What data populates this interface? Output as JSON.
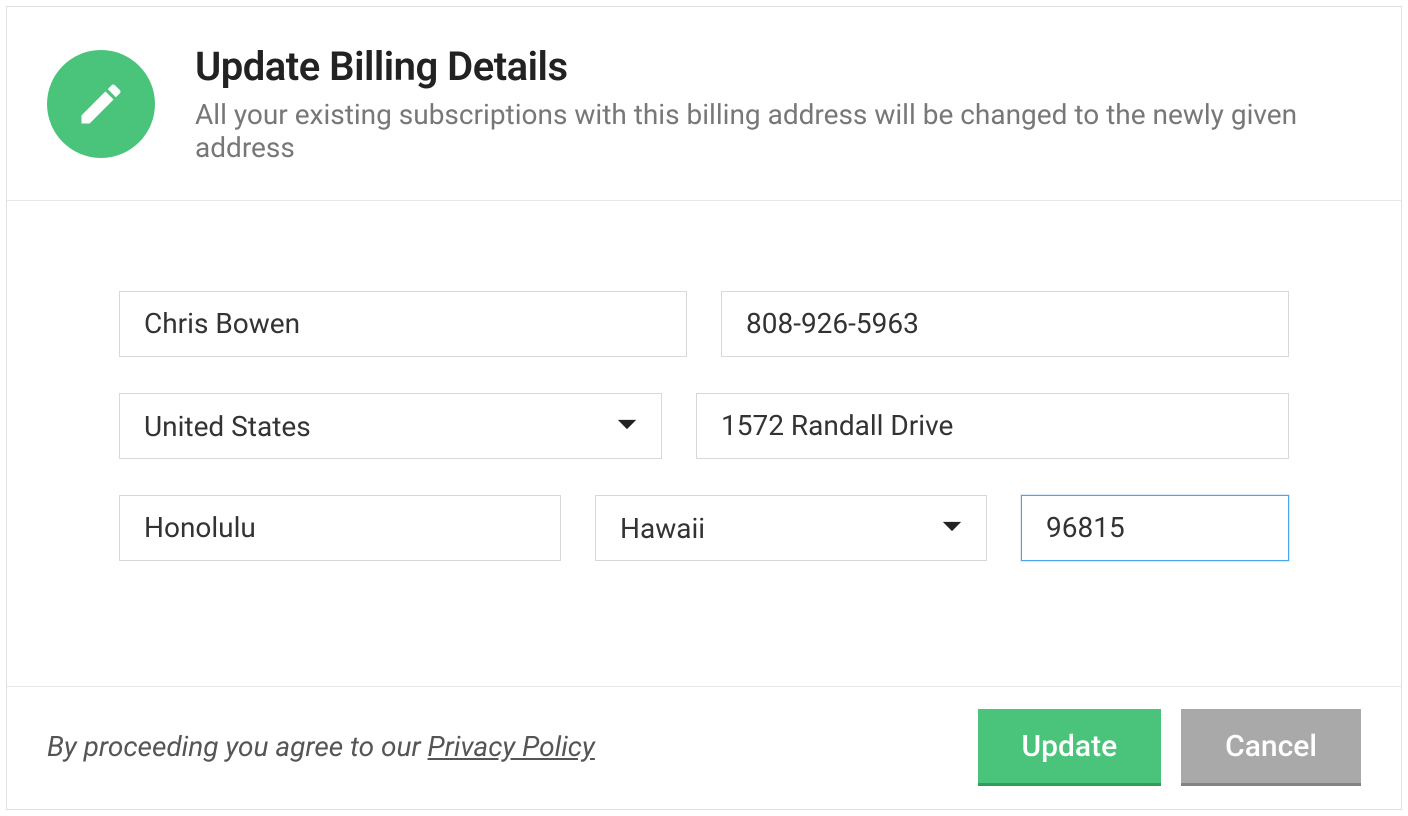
{
  "header": {
    "title": "Update Billing Details",
    "subtitle": "All your existing subscriptions with this billing address will be changed to the newly given address"
  },
  "form": {
    "name": "Chris Bowen",
    "phone": "808-926-5963",
    "country": "United States",
    "street": "1572 Randall Drive",
    "city": "Honolulu",
    "state": "Hawaii",
    "zip": "96815"
  },
  "footer": {
    "agree_prefix": "By proceeding you agree to our ",
    "privacy_label": "Privacy Policy",
    "update_label": "Update",
    "cancel_label": "Cancel"
  }
}
